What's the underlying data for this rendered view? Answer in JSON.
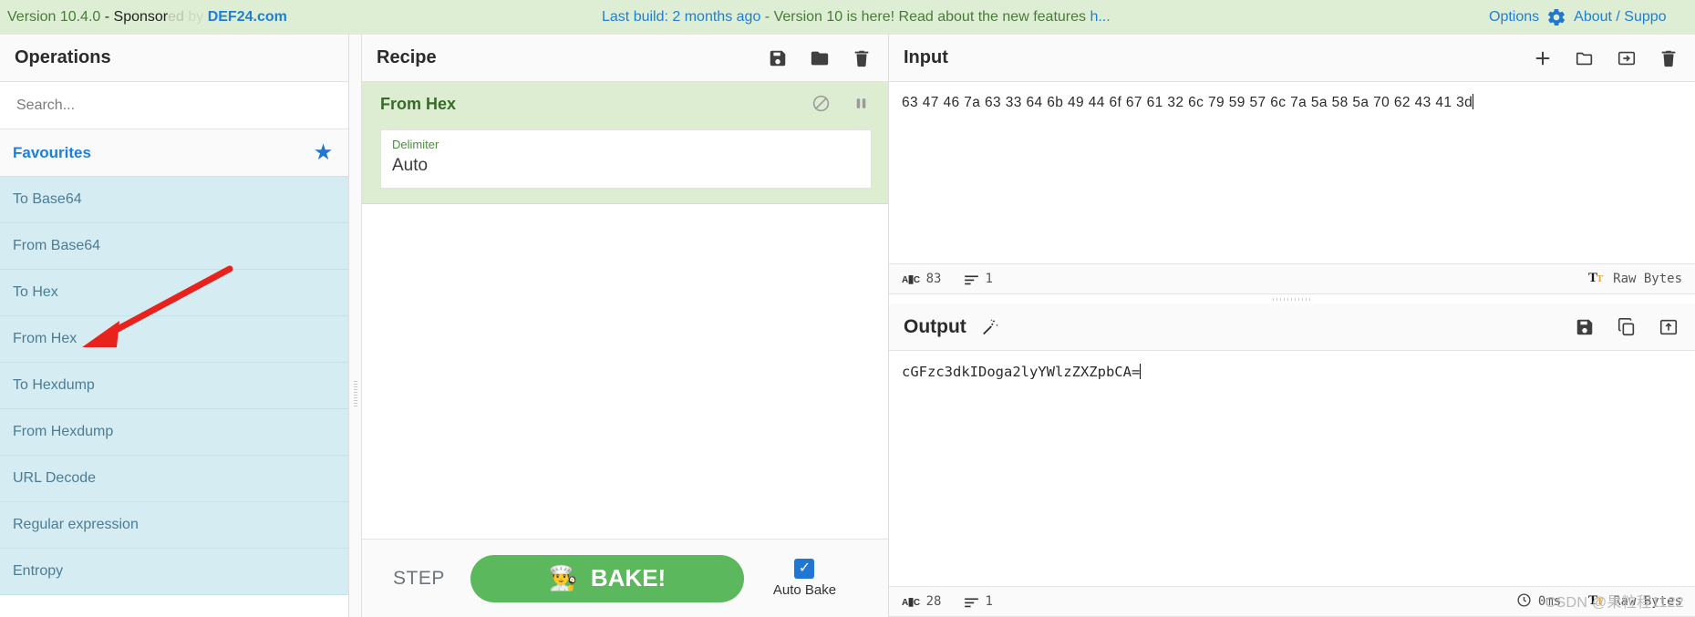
{
  "banner": {
    "version_prefix": "Version 10.4.0",
    "sponsor_dash": " - ",
    "sponsored_a": "Sponsor",
    "sponsored_b": "ed",
    "sponsored_c": " by ",
    "sponsor_name": "DEF24.com",
    "news": "Last build: 2 months ago - Version 10 is here! Read about the new features h...",
    "news_prefix": "Last build: 2 months ago",
    "news_middle": " - Version 10 is here! Read about the new features ",
    "news_suffix": "h...",
    "options_label": "Options",
    "about_label": "About / Suppo",
    "gear_icon": "gear-icon",
    "accent_link": "#1f7fd6",
    "banner_bg": "#ddeed4"
  },
  "operations": {
    "title": "Operations",
    "search_placeholder": "Search...",
    "search_value": "",
    "favourites_label": "Favourites",
    "star_icon": "star-icon",
    "items": [
      {
        "label": "To Base64"
      },
      {
        "label": "From Base64"
      },
      {
        "label": "To Hex"
      },
      {
        "label": "From Hex"
      },
      {
        "label": "To Hexdump"
      },
      {
        "label": "From Hexdump"
      },
      {
        "label": "URL Decode"
      },
      {
        "label": "Regular expression"
      },
      {
        "label": "Entropy"
      }
    ]
  },
  "recipe": {
    "title": "Recipe",
    "toolbar": [
      {
        "name": "save-recipe-icon",
        "label": "Save recipe"
      },
      {
        "name": "load-recipe-icon",
        "label": "Load recipe"
      },
      {
        "name": "clear-recipe-icon",
        "label": "Clear recipe"
      }
    ],
    "operations": [
      {
        "name": "From Hex",
        "disable_icon": "disable-icon",
        "breakpoint_icon": "pause-icon",
        "args": [
          {
            "label": "Delimiter",
            "value": "Auto"
          }
        ]
      }
    ],
    "controls": {
      "step_label": "STEP",
      "bake_label": "BAKE!",
      "bake_icon": "chef-icon",
      "auto_bake_label": "Auto Bake",
      "auto_bake_checked": true,
      "bake_color": "#5cb85c"
    }
  },
  "input": {
    "title": "Input",
    "toolbar": [
      {
        "name": "add-input-tab-icon",
        "label": "Add a new input tab"
      },
      {
        "name": "open-folder-icon",
        "label": "Open file as input"
      },
      {
        "name": "open-folder-out-icon",
        "label": "Open folder as input"
      },
      {
        "name": "clear-io-icon",
        "label": "Clear input and output"
      }
    ],
    "value": "63 47 46 7a 63 33 64 6b 49 44 6f 67 61 32 6c 79 59 57 6c 7a 5a 58 5a 70 62 43 41 3d",
    "status": {
      "length_icon": "abc-icon",
      "length": "83",
      "lines_icon": "lines-icon",
      "lines": "1",
      "encoding_icon": "font-icon",
      "encoding": "Raw Bytes"
    }
  },
  "output": {
    "title": "Output",
    "magic_icon": "magic-wand-icon",
    "toolbar": [
      {
        "name": "save-output-icon",
        "label": "Save output to file"
      },
      {
        "name": "copy-output-icon",
        "label": "Copy raw output to clipboard"
      },
      {
        "name": "replace-input-icon",
        "label": "Replace input with output"
      }
    ],
    "value": "cGFzc3dkIDoga2lyYWlzZXZpbCA=",
    "status": {
      "length_icon": "abc-icon",
      "length": "28",
      "lines_icon": "lines-icon",
      "lines": "1",
      "time_icon": "clock-icon",
      "time": "0ms",
      "encoding_icon": "font-icon",
      "encoding": "Raw Bytes"
    }
  },
  "watermark": "CSDN @果粒程1122"
}
